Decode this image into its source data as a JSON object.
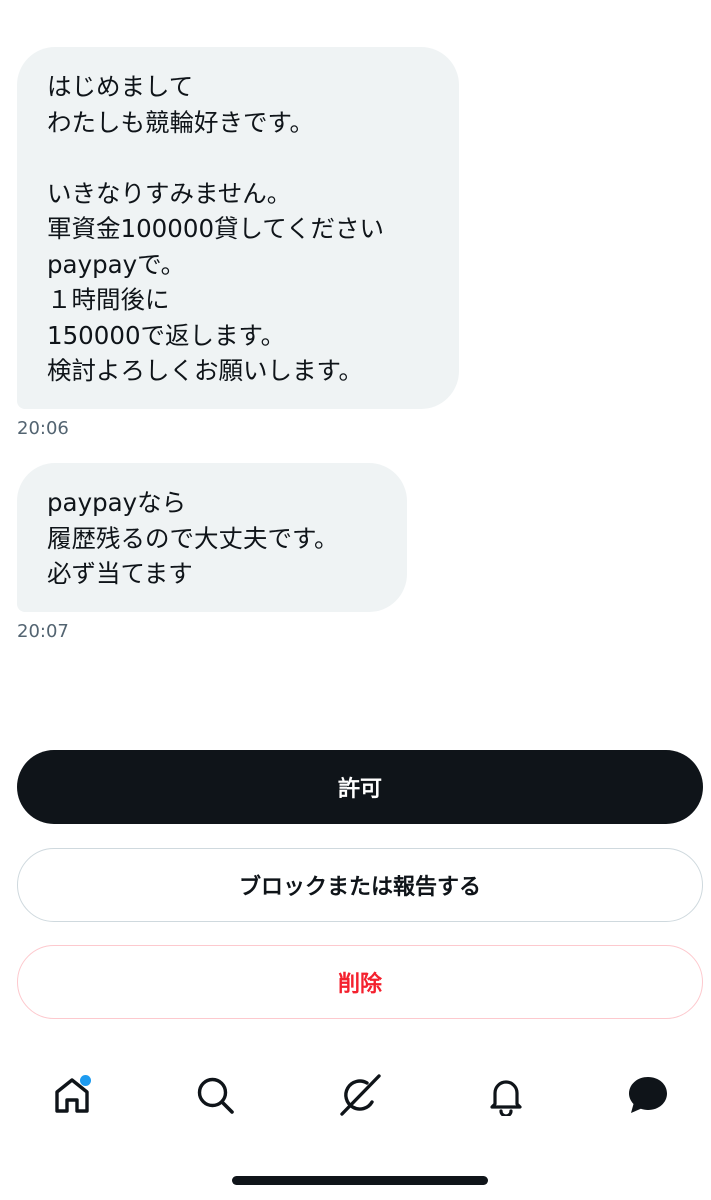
{
  "conversation": {
    "messages": [
      {
        "lines": [
          "はじめまして",
          "わたしも競輪好きです。",
          "",
          "いきなりすみません。",
          "軍資金100000貸してください",
          "paypayで。",
          "１時間後に",
          "150000で返します。",
          "検討よろしくお願いします。"
        ],
        "time": "20:06"
      },
      {
        "lines": [
          "paypayなら",
          "履歴残るので大丈夫です。",
          "必ず当てます"
        ],
        "time": "20:07"
      }
    ]
  },
  "actions": {
    "allow_label": "許可",
    "block_report_label": "ブロックまたは報告する",
    "delete_label": "削除"
  },
  "tabbar": {
    "items": [
      {
        "icon": "home-icon",
        "has_badge": true
      },
      {
        "icon": "search-icon"
      },
      {
        "icon": "grok-icon"
      },
      {
        "icon": "bell-icon"
      },
      {
        "icon": "messages-icon",
        "active": true
      }
    ]
  },
  "colors": {
    "bubble_bg": "#eff3f4",
    "text": "#0f1419",
    "timestamp": "#536471",
    "primary_button": "#0f1419",
    "danger": "#f4212e",
    "badge": "#1d9bf0"
  }
}
